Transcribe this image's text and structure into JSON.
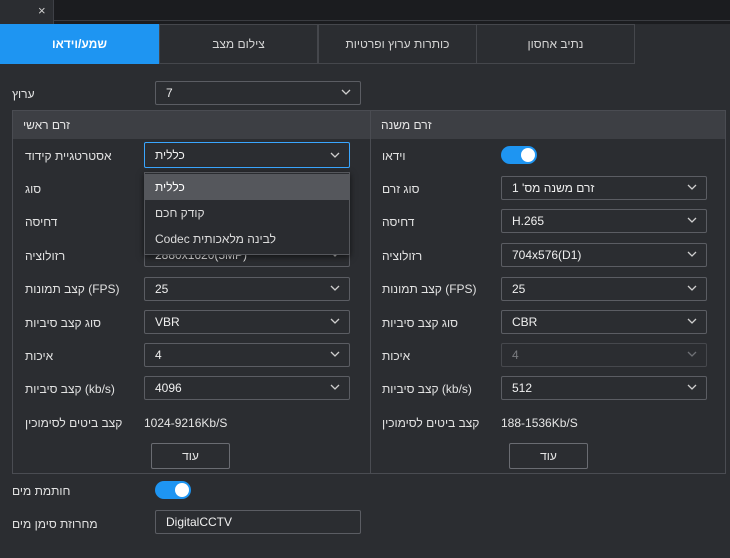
{
  "window": {
    "close_symbol": "×"
  },
  "tabs": [
    {
      "label": "שמע/וידאו",
      "active": true
    },
    {
      "label": "צילום מצב",
      "active": false
    },
    {
      "label": "כותרות ערוץ ופרטיות",
      "active": false
    },
    {
      "label": "נתיב אחסון",
      "active": false
    }
  ],
  "channel": {
    "label": "ערוץ",
    "value": "7"
  },
  "main_stream": {
    "header": "זרם ראשי",
    "encode_strategy": {
      "label": "אסטרטגיית קידוד",
      "value": "כללית"
    },
    "type": {
      "label": "סוג"
    },
    "compression": {
      "label": "דחיסה"
    },
    "resolution": {
      "label": "רזולוציה",
      "value": "2880x1620(5MP)"
    },
    "fps": {
      "label": "קצב תמונות (FPS)",
      "value": "25"
    },
    "bitrate_type": {
      "label": "סוג קצב סיביות",
      "value": "VBR"
    },
    "quality": {
      "label": "איכות",
      "value": "4"
    },
    "bitrate": {
      "label": "קצב סיביות (kb/s)",
      "value": "4096"
    },
    "ref_bitrate": {
      "label": "קצב ביטים לסימוכין",
      "value": "1024-9216Kb/S"
    },
    "more_button": "עוד"
  },
  "encode_dropdown": {
    "options": [
      "כללית",
      "קודק חכם",
      "Codec לבינה מלאכותית"
    ],
    "selected_index": 0
  },
  "sub_stream": {
    "header": "זרם משנה",
    "video": {
      "label": "וידאו",
      "enabled": true
    },
    "stream_type": {
      "label": "סוג זרם",
      "value": "זרם משנה מס' 1"
    },
    "compression": {
      "label": "דחיסה",
      "value": "H.265"
    },
    "resolution": {
      "label": "רזולוציה",
      "value": "704x576(D1)"
    },
    "fps": {
      "label": "קצב תמונות (FPS)",
      "value": "25"
    },
    "bitrate_type": {
      "label": "סוג קצב סיביות",
      "value": "CBR"
    },
    "quality": {
      "label": "איכות",
      "value": "4",
      "disabled": true
    },
    "bitrate": {
      "label": "קצב סיביות (kb/s)",
      "value": "512"
    },
    "ref_bitrate": {
      "label": "קצב ביטים לסימוכין",
      "value": "188-1536Kb/S"
    },
    "more_button": "עוד"
  },
  "watermark": {
    "label": "חותמת מים",
    "enabled": true,
    "string_label": "מחרוזת סימן מים",
    "string_value": "DigitalCCTV"
  },
  "colors": {
    "accent": "#1e95f2",
    "background": "#2b2d31",
    "panel_header": "#3d3f44"
  },
  "icons": {
    "chevron": "chevron-down-icon",
    "close": "close-icon"
  }
}
